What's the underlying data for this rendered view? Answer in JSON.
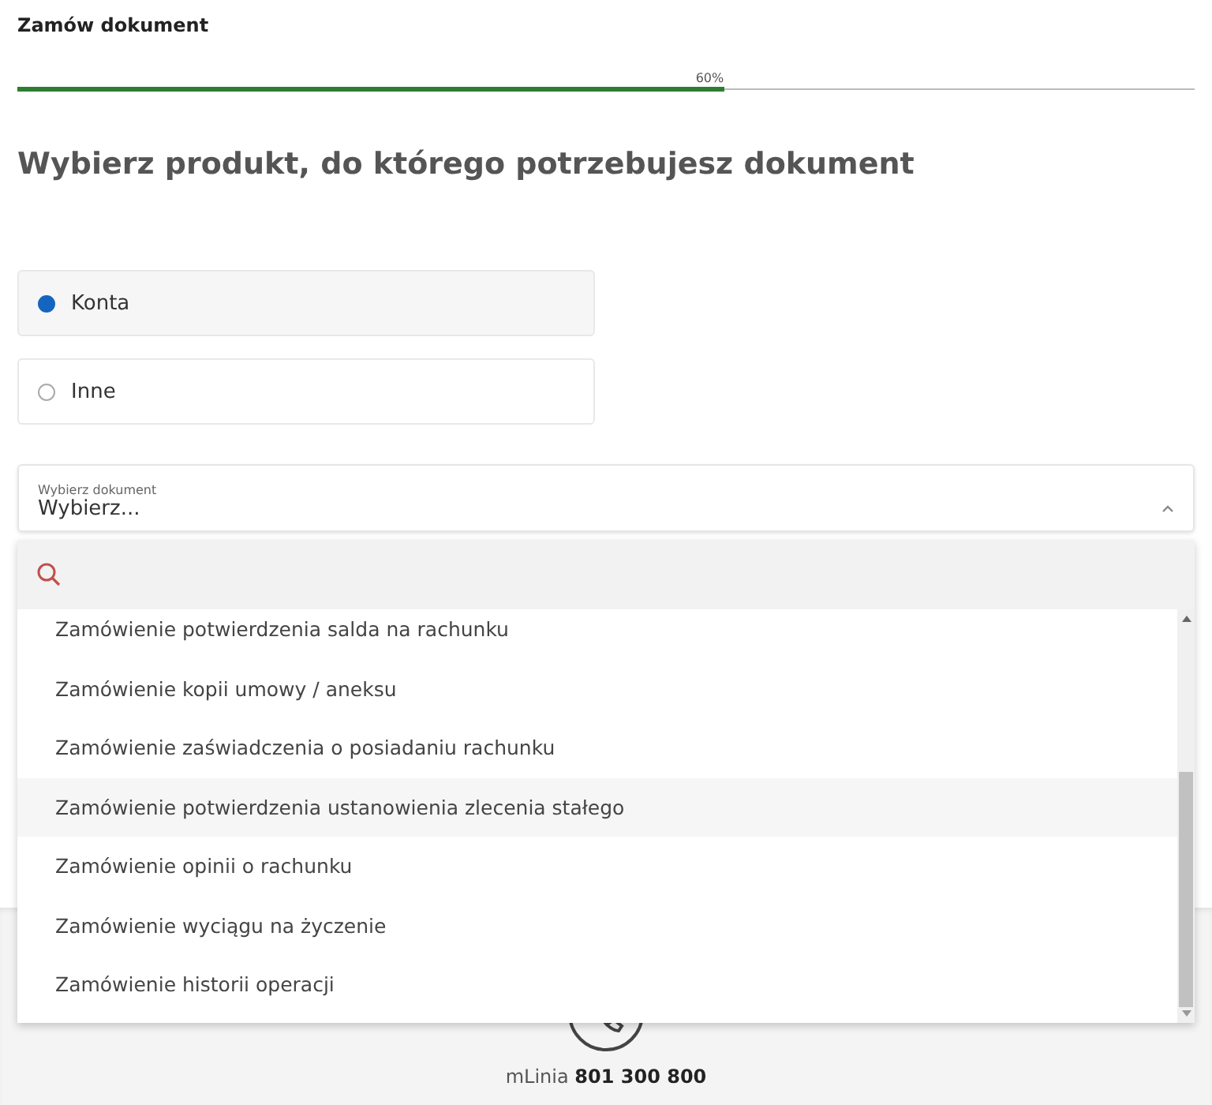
{
  "header": {
    "title": "Zamów dokument"
  },
  "progress": {
    "level": 0.6,
    "label": "60%"
  },
  "heading": "Wybierz produkt, do którego potrzebujesz dokument",
  "options": [
    {
      "label": "Konta",
      "selected": true
    },
    {
      "label": "Inne",
      "selected": false
    }
  ],
  "select": {
    "label": "Wybierz dokument",
    "value": "Wybierz...",
    "expanded": true
  },
  "dropdown": {
    "items": [
      {
        "label": "Zamówienie potwierdzenia salda na rachunku",
        "highlighted": false
      },
      {
        "label": "Zamówienie kopii umowy / aneksu",
        "highlighted": false
      },
      {
        "label": "Zamówienie zaświadczenia o posiadaniu rachunku",
        "highlighted": false
      },
      {
        "label": "Zamówienie potwierdzenia ustanowienia zlecenia stałego",
        "highlighted": true
      },
      {
        "label": "Zamówienie opinii o rachunku",
        "highlighted": false
      },
      {
        "label": "Zamówienie wyciągu na życzenie",
        "highlighted": false
      },
      {
        "label": "Zamówienie historii operacji",
        "highlighted": false
      }
    ]
  },
  "footer": {
    "hotline": "mLinia **801 300 800**"
  }
}
